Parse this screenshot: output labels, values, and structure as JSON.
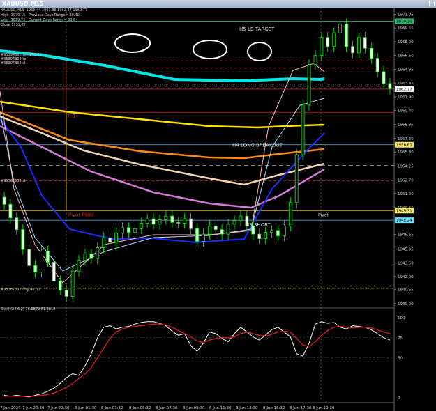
{
  "window": {
    "title": "XAUUSD,M15"
  },
  "info_lines": [
    "XAUUSD,M15  1963.44 1963.86 1962.37 1962.77",
    "High  1970.15   Previous Days Range= 30.40",
    "Low   1939.72   Current Days Range= 30.54",
    "Close 1939.87"
  ],
  "order_labels": [
    "#95394868 sell 200.00",
    "#95394863 tp",
    "#95394863 sl"
  ],
  "levels": [
    {
      "name": "H5 LB TARGET",
      "price": 1970.3,
      "color": "#2fb36b"
    },
    {
      "name": "R 1",
      "price": 1960.2,
      "color": "#d0281f"
    },
    {
      "name": "H4 LONG BREAKOUT",
      "price": 1956.61,
      "color": "#5fb7ff"
    },
    {
      "name": "Pivot Point",
      "price": 1949.31,
      "color": "#ffd700"
    },
    {
      "name": "Pivot",
      "price": 1949.31,
      "color": "#cccccc"
    },
    {
      "name": "H3 SHORT",
      "price": 1948.24,
      "color": "#5fb7ff"
    }
  ],
  "buy_label": "#95367032 buy 40.00",
  "dotted_label": "#95367032 sl",
  "price_badges": [
    {
      "text": "1970.30",
      "bg": "#2fb36b",
      "fg": "#000"
    },
    {
      "text": "1962.77",
      "bg": "#ffffff",
      "fg": "#000"
    },
    {
      "text": "1956.61",
      "bg": "#f1e46a",
      "fg": "#000"
    },
    {
      "text": "1949.31",
      "bg": "#f1e46a",
      "fg": "#000"
    },
    {
      "text": "1948.24",
      "bg": "#6ee0ff",
      "fg": "#000"
    }
  ],
  "stoch_label": "Stoch(34,6,2) 76.9879 81.4818",
  "chart_data": [
    {
      "type": "candlestick",
      "title": "XAUUSD,M15",
      "ylim": [
        1938.6,
        1971.8
      ],
      "yticks": [
        "1971.05",
        "1969.55",
        "1968.00",
        "1966.50",
        "1964.95",
        "1963.45",
        "1961.90",
        "1960.40",
        "1958.85",
        "1957.30",
        "1955.80",
        "1954.25",
        "1952.70",
        "1951.20",
        "1949.65",
        "1948.10",
        "1946.65",
        "1945.05",
        "1943.50",
        "1942.00",
        "1940.55",
        "1939.00"
      ],
      "xticks": [
        "7 Jun 2023",
        "7 Jun 20:30",
        "7 Jun 22:30",
        "8 Jun 01:30",
        "8 Jun 03:30",
        "8 Jun 05:30",
        "8 Jun 07:30",
        "8 Jun 09:30",
        "8 Jun 11:30",
        "8 Jun 13:30",
        "8 Jun 15:30",
        "8 Jun 17:30",
        "8 Jun 19:30"
      ],
      "close": [
        1950.0,
        1948.5,
        1947.2,
        1945.0,
        1943.2,
        1942.5,
        1944.8,
        1943.6,
        1941.5,
        1940.5,
        1939.8,
        1942.6,
        1943.8,
        1944.5,
        1944.0,
        1945.2,
        1946.3,
        1945.8,
        1946.8,
        1947.4,
        1946.9,
        1947.3,
        1947.9,
        1948.4,
        1947.8,
        1948.3,
        1948.7,
        1948.0,
        1947.9,
        1948.4,
        1947.3,
        1945.9,
        1946.7,
        1947.6,
        1947.2,
        1946.7,
        1947.8,
        1948.2,
        1948.7,
        1947.6,
        1946.7,
        1946.2,
        1946.9,
        1947.1,
        1946.5,
        1947.6,
        1950.2,
        1955.5,
        1961.0,
        1965.5,
        1966.5,
        1968.5,
        1967.5,
        1969.0,
        1970.0,
        1967.5,
        1966.8,
        1968.5,
        1967.3,
        1966.2,
        1964.7,
        1963.4,
        1962.8
      ]
    },
    {
      "type": "line",
      "title": "Stoch(34,6,2)",
      "ylim": [
        0,
        100
      ],
      "yticks": [
        "100",
        "75",
        "50",
        "0"
      ],
      "series": [
        {
          "color": "#ffffff",
          "values": [
            3,
            2,
            3,
            2,
            1,
            3,
            5,
            8,
            12,
            18,
            25,
            30,
            28,
            40,
            55,
            75,
            88,
            90,
            86,
            88,
            89,
            92,
            94,
            95,
            95,
            93,
            90,
            83,
            78,
            80,
            65,
            58,
            68,
            82,
            80,
            74,
            70,
            80,
            88,
            82,
            76,
            72,
            78,
            85,
            88,
            82,
            76,
            55,
            52,
            68,
            92,
            95,
            93,
            94,
            88,
            86,
            90,
            89,
            88,
            85,
            80,
            75,
            72
          ]
        },
        {
          "color": "#cc1f1f",
          "values": [
            2,
            2,
            2,
            2,
            2,
            2,
            3,
            4,
            6,
            9,
            13,
            18,
            24,
            30,
            38,
            50,
            62,
            74,
            82,
            86,
            88,
            89,
            90,
            91,
            92,
            92,
            91,
            88,
            84,
            80,
            76,
            71,
            69,
            72,
            74,
            75,
            75,
            76,
            80,
            82,
            80,
            78,
            77,
            79,
            82,
            83,
            82,
            74,
            66,
            64,
            70,
            78,
            84,
            88,
            89,
            88,
            87,
            88,
            88,
            87,
            85,
            82,
            80
          ]
        }
      ]
    }
  ]
}
